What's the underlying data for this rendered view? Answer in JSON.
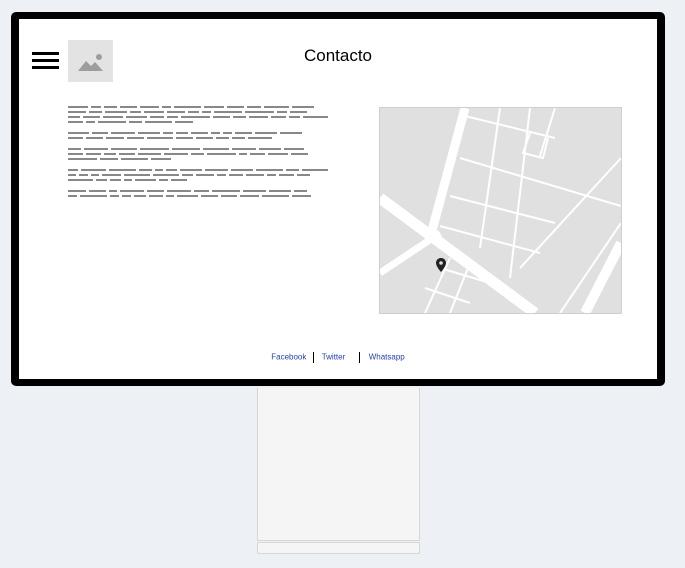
{
  "page": {
    "title": "Contacto"
  },
  "header": {
    "menu_icon": "hamburger-menu-icon",
    "logo_icon": "image-placeholder-icon"
  },
  "map": {
    "pin_icon": "map-pin-icon"
  },
  "footer": {
    "links": [
      "Facebook",
      "Twitter",
      "Whatsapp"
    ]
  },
  "colors": {
    "frame": "#000000",
    "background": "#edf0f5",
    "link": "#2541b2",
    "map_bg": "#e0e0e0"
  }
}
